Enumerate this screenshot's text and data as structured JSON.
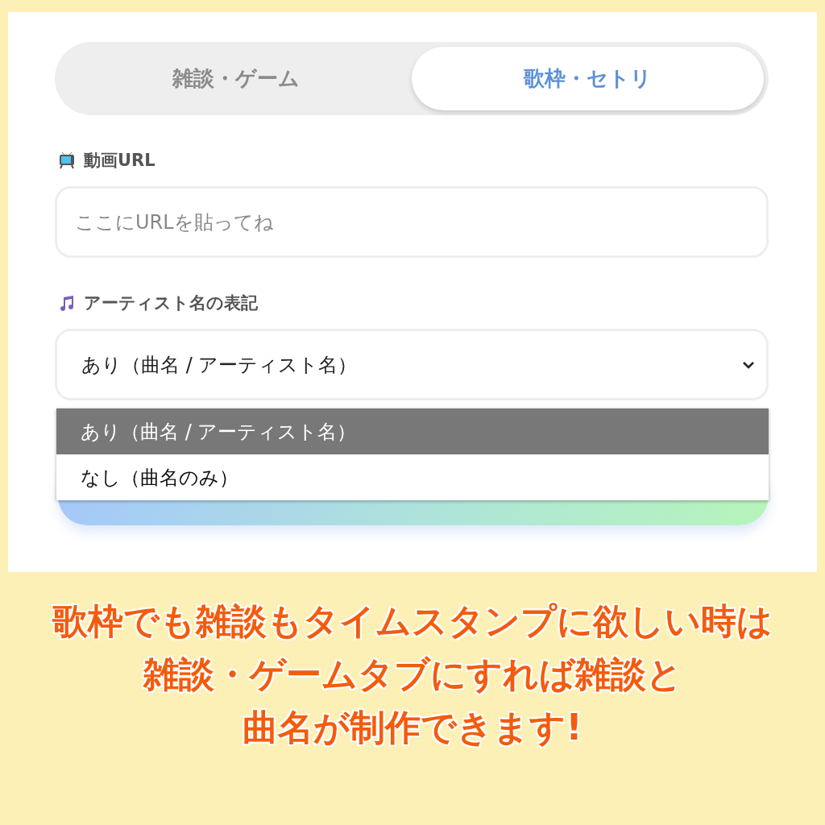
{
  "tabs": [
    {
      "label": "雑談・ゲーム",
      "selected": false
    },
    {
      "label": "歌枠・セトリ",
      "selected": true
    }
  ],
  "url_field": {
    "label": "動画URL",
    "placeholder": "ここにURLを貼ってね"
  },
  "artist_select": {
    "label": "アーティスト名の表記",
    "value": "あり（曲名 / アーティスト名）",
    "options": [
      {
        "label": "あり（曲名 / アーティスト名）",
        "selected": true
      },
      {
        "label": "なし（曲名のみ）",
        "selected": false
      }
    ]
  },
  "caption": [
    "歌枠でも雑談もタイムスタンプに欲しい時は",
    "雑談・ゲームタブにすれば雑談と",
    "曲名が制作できます!"
  ]
}
